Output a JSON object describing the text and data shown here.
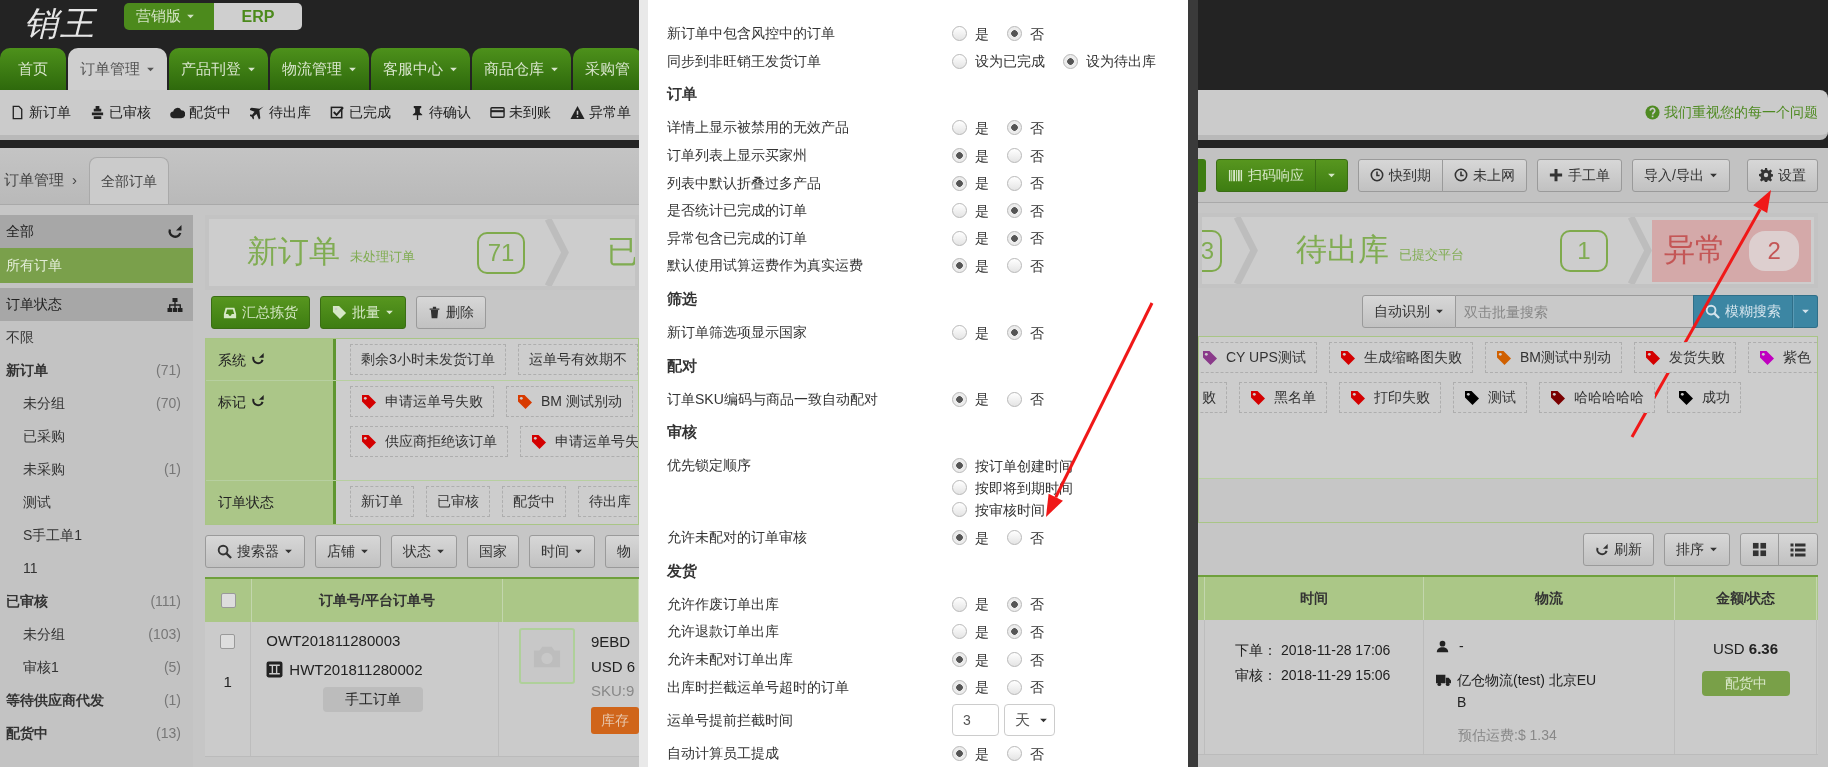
{
  "header": {
    "logo": "销王",
    "edition": "营销版",
    "product": "ERP"
  },
  "nav_tabs": [
    {
      "label": "首页",
      "selected": false,
      "dropdown": false
    },
    {
      "label": "订单管理",
      "selected": true,
      "dropdown": true
    },
    {
      "label": "产品刊登",
      "selected": false,
      "dropdown": true
    },
    {
      "label": "物流管理",
      "selected": false,
      "dropdown": true
    },
    {
      "label": "客服中心",
      "selected": false,
      "dropdown": true
    },
    {
      "label": "商品仓库",
      "selected": false,
      "dropdown": true
    },
    {
      "label": "采购管",
      "selected": false,
      "dropdown": false
    }
  ],
  "quick_links": [
    "新订单",
    "已审核",
    "配货中",
    "待出库",
    "已完成",
    "待确认",
    "未到账",
    "异常单"
  ],
  "breadcrumb": {
    "root": "订单管理",
    "separator": "›",
    "current": "全部订单"
  },
  "sidebar": {
    "groups": [
      {
        "title": "全部",
        "items": [
          {
            "label": "所有订单",
            "selected": true
          }
        ]
      },
      {
        "title": "订单状态",
        "items": [
          {
            "label": "不限",
            "kind": "all",
            "selected": false
          },
          {
            "label": "新订单",
            "kind": "status",
            "count": "(71)",
            "selected": false,
            "children": [
              {
                "label": "未分组",
                "count": "(70)",
                "selected": false
              },
              {
                "label": "已采购",
                "selected": false
              },
              {
                "label": "未采购",
                "count": "(1)",
                "selected": false
              },
              {
                "label": "测试",
                "selected": false
              },
              {
                "label": "S手工单1",
                "selected": false
              },
              {
                "label": "11",
                "selected": false
              }
            ]
          },
          {
            "label": "已审核",
            "kind": "status",
            "count": "(111)",
            "selected": false,
            "children": [
              {
                "label": "未分组",
                "count": "(103)",
                "selected": false
              },
              {
                "label": "审核1",
                "count": "(5)",
                "selected": false
              }
            ]
          },
          {
            "label": "等待供应商代发",
            "kind": "status",
            "count": "(1)",
            "selected": false
          },
          {
            "label": "配货中",
            "kind": "status",
            "count": "(13)",
            "selected": false
          }
        ]
      }
    ]
  },
  "page_left": {
    "status_steps": [
      {
        "kind": "step",
        "label": "新订单",
        "hint": "未处理订单",
        "count": "71"
      },
      {
        "kind": "step",
        "label": "已"
      }
    ],
    "actions": {
      "pick_button": "汇总拣货",
      "batch_button": "批量",
      "delete_button": "删除"
    },
    "filters": [
      {
        "label": "系统",
        "refresh": true,
        "lines": [
          [
            {
              "label": "剩余3小时未发货订单"
            },
            {
              "label": "运单号有效期不"
            }
          ]
        ]
      },
      {
        "label": "标记",
        "refresh": true,
        "lines": [
          [
            {
              "label": "申请运单号失败",
              "color": "#d40000"
            },
            {
              "label": "BM 测试别动",
              "color": "#d83a00"
            }
          ],
          [
            {
              "label": "供应商拒绝该订单",
              "color": "#d40000"
            },
            {
              "label": "申请运单号失",
              "color": "#d40000"
            }
          ]
        ]
      },
      {
        "label": "订单状态",
        "refresh": false,
        "lines": [
          [
            {
              "label": "新订单"
            },
            {
              "label": "已审核"
            },
            {
              "label": "配货中"
            },
            {
              "label": "待出库"
            }
          ]
        ]
      }
    ],
    "search_buttons": [
      {
        "label": "搜索器",
        "dropdown": true
      },
      {
        "label": "店铺",
        "dropdown": true
      },
      {
        "label": "状态",
        "dropdown": true
      },
      {
        "label": "国家",
        "dropdown": false
      },
      {
        "label": "时间",
        "dropdown": true
      },
      {
        "label": "物",
        "dropdown": false
      }
    ],
    "table": {
      "columns": [
        "订单号/平台订单号"
      ],
      "header_checked": false,
      "row": {
        "checked": false,
        "index": "1",
        "order_no": "OWT201811280003",
        "platform_no": "HWT201811280002",
        "source": "手工订单",
        "product_code": "9EBD",
        "price": "USD 6",
        "sku": "SKU:9",
        "stock_tag": "库存"
      }
    }
  },
  "settings_dialog": {
    "sections": [
      {
        "settings": [
          {
            "kind": "radio",
            "label": "新订单中包含风控中的订单",
            "options": [
              {
                "label": "是",
                "selected": false
              },
              {
                "label": "否",
                "selected": true
              }
            ]
          },
          {
            "kind": "radio",
            "label": "同步到非旺销王发货订单",
            "options": [
              {
                "label": "设为已完成",
                "selected": false
              },
              {
                "label": "设为待出库",
                "selected": true
              }
            ]
          }
        ]
      },
      {
        "title": "订单",
        "settings": [
          {
            "kind": "radio",
            "label": "详情上显示被禁用的无效产品",
            "options": [
              {
                "label": "是",
                "selected": false
              },
              {
                "label": "否",
                "selected": true
              }
            ]
          },
          {
            "kind": "radio",
            "label": "订单列表上显示买家州",
            "options": [
              {
                "label": "是",
                "selected": true
              },
              {
                "label": "否",
                "selected": false
              }
            ]
          },
          {
            "kind": "radio",
            "label": "列表中默认折叠过多产品",
            "options": [
              {
                "label": "是",
                "selected": true
              },
              {
                "label": "否",
                "selected": false
              }
            ]
          },
          {
            "kind": "radio",
            "label": "是否统计已完成的订单",
            "options": [
              {
                "label": "是",
                "selected": false
              },
              {
                "label": "否",
                "selected": true
              }
            ]
          },
          {
            "kind": "radio",
            "label": "异常包含已完成的订单",
            "options": [
              {
                "label": "是",
                "selected": false
              },
              {
                "label": "否",
                "selected": true
              }
            ]
          },
          {
            "kind": "radio",
            "label": "默认使用试算运费作为真实运费",
            "options": [
              {
                "label": "是",
                "selected": true
              },
              {
                "label": "否",
                "selected": false
              }
            ]
          }
        ]
      },
      {
        "title": "筛选",
        "settings": [
          {
            "kind": "radio",
            "label": "新订单筛选项显示国家",
            "options": [
              {
                "label": "是",
                "selected": false
              },
              {
                "label": "否",
                "selected": true
              }
            ]
          }
        ]
      },
      {
        "title": "配对",
        "settings": [
          {
            "kind": "radio",
            "label": "订单SKU编码与商品一致自动配对",
            "options": [
              {
                "label": "是",
                "selected": true
              },
              {
                "label": "否",
                "selected": false
              }
            ]
          }
        ]
      },
      {
        "title": "审核",
        "settings": [
          {
            "kind": "radio-vertical",
            "label": "优先锁定顺序",
            "options": [
              {
                "label": "按订单创建时间",
                "selected": true
              },
              {
                "label": "按即将到期时间",
                "selected": false
              },
              {
                "label": "按审核时间",
                "selected": false
              }
            ]
          },
          {
            "kind": "radio",
            "label": "允许未配对的订单审核",
            "options": [
              {
                "label": "是",
                "selected": true
              },
              {
                "label": "否",
                "selected": false
              }
            ]
          }
        ]
      },
      {
        "title": "发货",
        "settings": [
          {
            "kind": "radio",
            "label": "允许作废订单出库",
            "options": [
              {
                "label": "是",
                "selected": false
              },
              {
                "label": "否",
                "selected": true
              }
            ]
          },
          {
            "kind": "radio",
            "label": "允许退款订单出库",
            "options": [
              {
                "label": "是",
                "selected": false
              },
              {
                "label": "否",
                "selected": true
              }
            ]
          },
          {
            "kind": "radio",
            "label": "允许未配对订单出库",
            "options": [
              {
                "label": "是",
                "selected": true
              },
              {
                "label": "否",
                "selected": false
              }
            ]
          },
          {
            "kind": "radio",
            "label": "出库时拦截运单号超时的订单",
            "options": [
              {
                "label": "是",
                "selected": true
              },
              {
                "label": "否",
                "selected": false
              }
            ]
          },
          {
            "kind": "number",
            "label": "运单号提前拦截时间",
            "value": "3",
            "unit": "天"
          },
          {
            "kind": "radio",
            "label": "自动计算员工提成",
            "options": [
              {
                "label": "是",
                "selected": true
              },
              {
                "label": "否",
                "selected": false
              }
            ]
          }
        ]
      }
    ]
  },
  "page_right": {
    "help_link": "我们重视您的每一个问题",
    "toolbar": {
      "scan_button": "扫码响应",
      "expiring_button": "快到期",
      "not_online_button": "未上网",
      "manual_button": "手工单",
      "import_export_button": "导入/导出",
      "settings_button": "设置"
    },
    "status_steps": [
      {
        "kind": "step",
        "count": "3"
      },
      {
        "kind": "step",
        "label": "待出库",
        "hint": "已提交平台",
        "count": "1"
      },
      {
        "kind": "alert",
        "label": "异常",
        "count": "2"
      }
    ],
    "search": {
      "mode": "自动识别",
      "placeholder": "双击批量搜索",
      "button": "模糊搜索"
    },
    "mark_lines": [
      [
        {
          "label": "CY UPS测试",
          "color": "#8a3a8a"
        },
        {
          "label": "生成缩略图失败",
          "color": "#d40000"
        },
        {
          "label": "BM测试中别动",
          "color": "#d06000"
        },
        {
          "label": "发货失败",
          "color": "#d40000"
        },
        {
          "label": "紫色",
          "color": "#c000c0"
        }
      ],
      [
        {
          "label": "败"
        },
        {
          "label": "黑名单",
          "color": "#d40000"
        },
        {
          "label": "打印失败",
          "color": "#d40000"
        },
        {
          "label": "测试",
          "color": "#000000"
        },
        {
          "label": "哈哈哈哈哈",
          "color": "#7a0000"
        },
        {
          "label": "成功",
          "color": "#000000"
        }
      ]
    ],
    "list_tools": {
      "refresh_button": "刷新",
      "sort_button": "排序"
    },
    "table": {
      "columns": [
        "时间",
        "物流",
        "金额/状态"
      ],
      "row": {
        "order_time": "下单： 2018-11-28 17:06",
        "audit_time": "审核： 2018-11-29 15:06",
        "buyer": "-",
        "carrier": "亿仓物流(test) 北京EUB",
        "shipping_estimate": "预估运费:$ 1.34",
        "amount": "USD **6.36**",
        "status": "配货中"
      }
    }
  },
  "annotations": [
    {
      "kind": "arrow"
    },
    {
      "kind": "arrow"
    }
  ]
}
